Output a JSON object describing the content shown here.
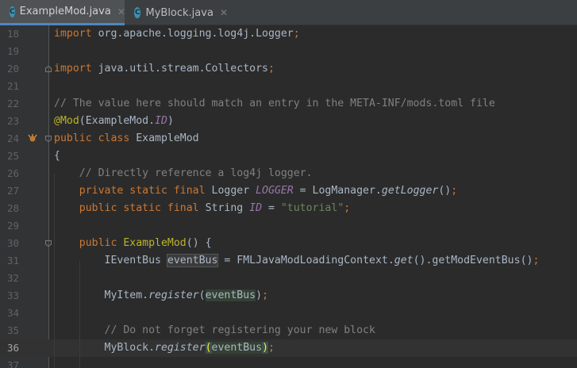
{
  "tabs": [
    {
      "label": "ExampleMod.java",
      "icon": "C",
      "active": true
    },
    {
      "label": "MyBlock.java",
      "icon": "C",
      "active": false
    }
  ],
  "lines": [
    {
      "num": "18",
      "tokens": [
        [
          "kw",
          "import "
        ],
        [
          "",
          "org.apache.logging.log4j.Logger"
        ],
        [
          "kw",
          ";"
        ]
      ]
    },
    {
      "num": "19",
      "tokens": []
    },
    {
      "num": "20",
      "tokens": [
        [
          "kw",
          "import "
        ],
        [
          "",
          "java.util.stream.Collectors"
        ],
        [
          "kw",
          ";"
        ]
      ]
    },
    {
      "num": "21",
      "tokens": []
    },
    {
      "num": "22",
      "tokens": [
        [
          "cmt",
          "// The value here should match an entry in the META-INF/mods.toml file"
        ]
      ]
    },
    {
      "num": "23",
      "tokens": [
        [
          "ann",
          "@Mod"
        ],
        [
          "",
          "(ExampleMod."
        ],
        [
          "const",
          "ID"
        ],
        [
          "",
          ")"
        ]
      ]
    },
    {
      "num": "24",
      "tokens": [
        [
          "kw",
          "public class "
        ],
        [
          "",
          "ExampleMod"
        ]
      ]
    },
    {
      "num": "25",
      "tokens": [
        [
          "",
          "{"
        ]
      ]
    },
    {
      "num": "26",
      "tokens": [
        [
          "",
          "    "
        ],
        [
          "cmt",
          "// Directly reference a log4j logger."
        ]
      ]
    },
    {
      "num": "27",
      "tokens": [
        [
          "",
          "    "
        ],
        [
          "kw",
          "private static final "
        ],
        [
          "",
          "Logger "
        ],
        [
          "const",
          "LOGGER"
        ],
        [
          "",
          " = LogManager."
        ],
        [
          "it",
          "getLogger"
        ],
        [
          "",
          "()"
        ],
        [
          "kw",
          ";"
        ]
      ]
    },
    {
      "num": "28",
      "tokens": [
        [
          "",
          "    "
        ],
        [
          "kw",
          "public static final "
        ],
        [
          "",
          "String "
        ],
        [
          "const",
          "ID"
        ],
        [
          "",
          " = "
        ],
        [
          "str",
          "\"tutorial\""
        ],
        [
          "kw",
          ";"
        ]
      ]
    },
    {
      "num": "29",
      "tokens": []
    },
    {
      "num": "30",
      "tokens": [
        [
          "",
          "    "
        ],
        [
          "kw",
          "public "
        ],
        [
          "ann",
          "ExampleMod"
        ],
        [
          "",
          "() {"
        ]
      ]
    },
    {
      "num": "31",
      "tokens": [
        [
          "",
          "        IEventBus "
        ],
        [
          "hlbox",
          "eventBus"
        ],
        [
          "",
          " = FMLJavaModLoadingContext."
        ],
        [
          "it",
          "get"
        ],
        [
          "",
          "().getModEventBus()"
        ],
        [
          "kw",
          ";"
        ]
      ]
    },
    {
      "num": "32",
      "tokens": []
    },
    {
      "num": "33",
      "tokens": [
        [
          "",
          "        MyItem."
        ],
        [
          "it",
          "register"
        ],
        [
          "",
          "("
        ],
        [
          "hl",
          "eventBus"
        ],
        [
          "",
          ")"
        ],
        [
          "kw",
          ";"
        ]
      ]
    },
    {
      "num": "34",
      "tokens": []
    },
    {
      "num": "35",
      "tokens": [
        [
          "",
          "        "
        ],
        [
          "cmt",
          "// Do not forget registering your new block"
        ]
      ]
    },
    {
      "num": "36",
      "tokens": [
        [
          "",
          "        MyBlock."
        ],
        [
          "it",
          "register"
        ],
        [
          "brace",
          "("
        ],
        [
          "hl",
          "eventBus"
        ],
        [
          "brace",
          ")"
        ],
        [
          "kw",
          ";"
        ]
      ],
      "current": true
    },
    {
      "num": "37",
      "tokens": []
    }
  ]
}
